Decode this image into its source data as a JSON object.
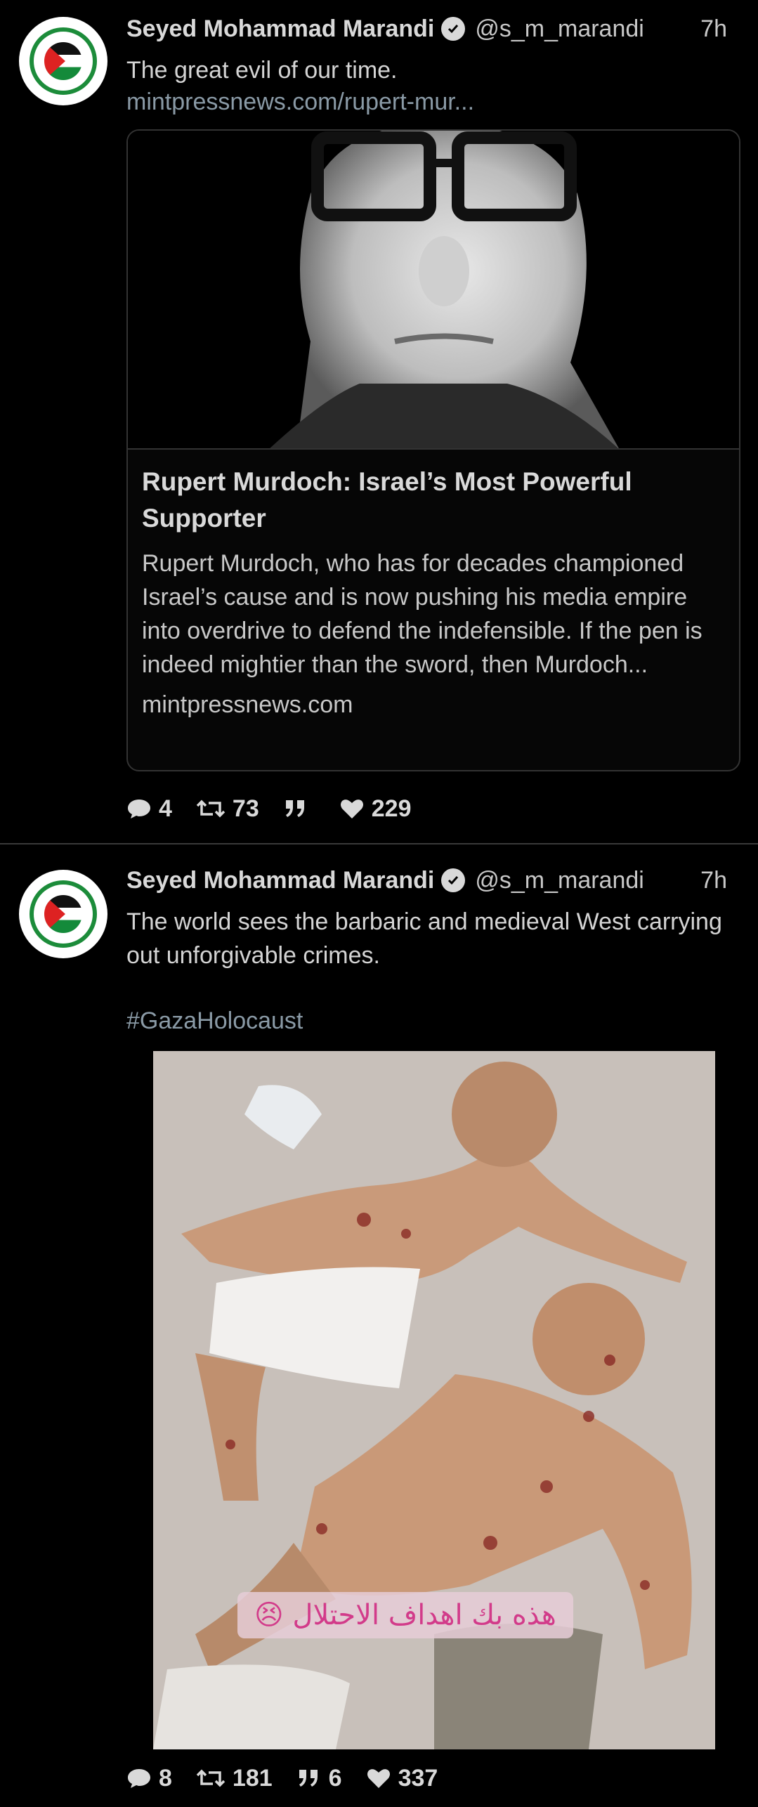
{
  "tweets": [
    {
      "author": "Seyed Mohammad Marandi",
      "handle": "@s_m_marandi",
      "time": "7h",
      "text": "The great evil of our time.",
      "link": "mintpressnews.com/rupert-mur...",
      "card": {
        "title": "Rupert Murdoch: Israel’s Most Powerful Supporter",
        "description": "Rupert Murdoch, who has for decades championed Israel’s cause and is now pushing his media empire into overdrive to defend the indefensible. If the pen is indeed mightier than the sword, then Murdoch...",
        "domain": "mintpressnews.com"
      },
      "stats": {
        "replies": "4",
        "retweets": "73",
        "quotes": "",
        "likes": "229"
      }
    },
    {
      "author": "Seyed Mohammad Marandi",
      "handle": "@s_m_marandi",
      "time": "7h",
      "text": "The world sees the barbaric and medieval West carrying out unforgivable crimes.",
      "hashtag": "#GazaHolocaust",
      "media_caption": "هذه بك اهداف الاحتلال 😣",
      "stats": {
        "replies": "8",
        "retweets": "181",
        "quotes": "6",
        "likes": "337"
      }
    }
  ],
  "icons": [
    "reply-icon",
    "retweet-icon",
    "quote-icon",
    "like-icon",
    "verified-icon"
  ],
  "colors": {
    "background": "#000000",
    "text": "#d9d9d9",
    "link": "#8a9aa6",
    "divider": "#3a3a3a"
  }
}
